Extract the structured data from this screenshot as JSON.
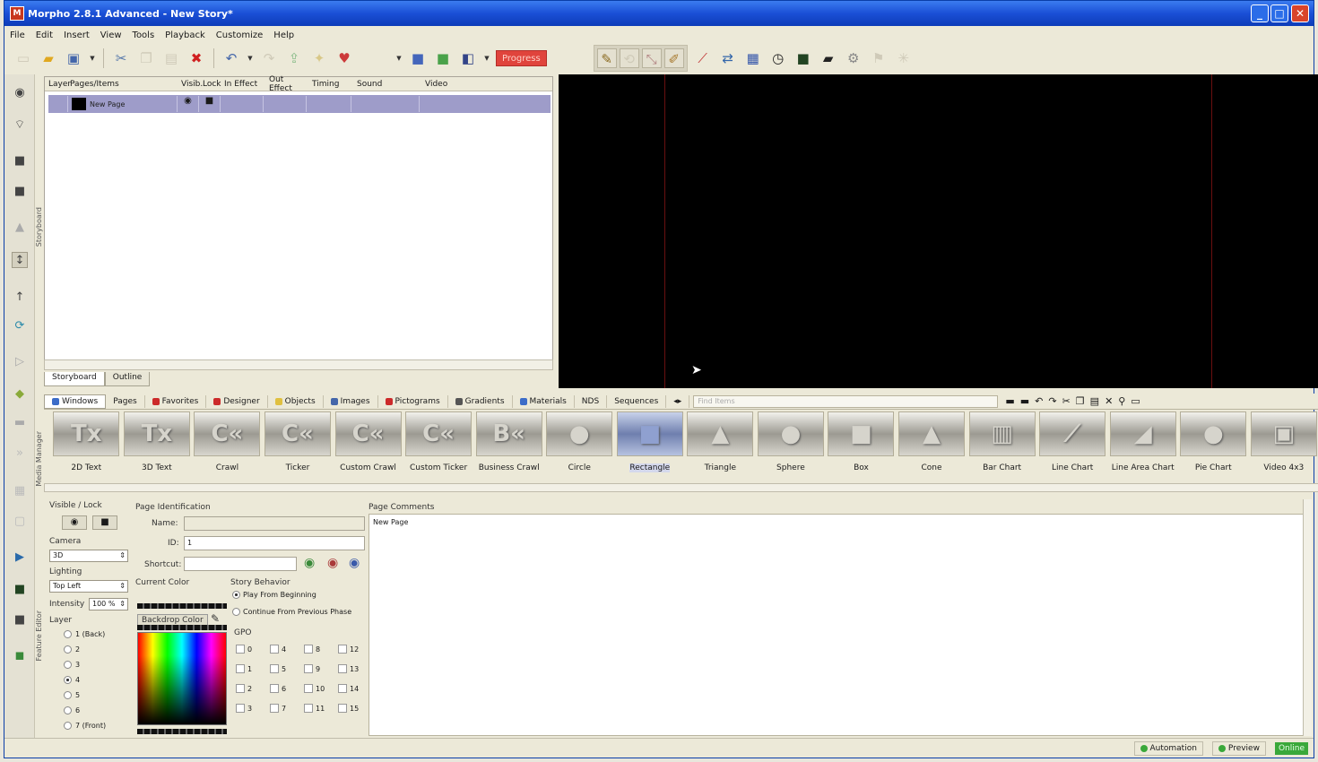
{
  "window": {
    "title": "Morpho 2.8.1 Advanced - New Story*",
    "icon_text": "M"
  },
  "window_controls": {
    "minimize": "_",
    "maximize": "□",
    "close": "✕"
  },
  "menu": [
    "File",
    "Edit",
    "Insert",
    "View",
    "Tools",
    "Playback",
    "Customize",
    "Help"
  ],
  "toolbar": {
    "progress_label": "Progress"
  },
  "storyboard": {
    "columns": [
      "Layer",
      "Pages/Items",
      "Visib.",
      "Lock",
      "In Effect",
      "Out Effect",
      "Timing",
      "Sound",
      "Video"
    ],
    "row": {
      "item_name": "New Page"
    },
    "tabs": [
      "Storyboard",
      "Outline"
    ],
    "side_label": "Storyboard"
  },
  "object_tabs": [
    "Windows",
    "Pages",
    "Favorites",
    "Designer",
    "Objects",
    "Images",
    "Pictograms",
    "Gradients",
    "Materials",
    "NDS",
    "Sequences"
  ],
  "object_tab_colors": [
    "#3c6cc8",
    "#b0a88c",
    "#cc2a2a",
    "#cc2a2a",
    "#e0c040",
    "#4466aa",
    "#cc2a2a",
    "#555555",
    "#3c6cc8",
    "#b0a88c",
    "#b0a88c"
  ],
  "search_placeholder": "Find Items",
  "objects": [
    {
      "label": "2D Text",
      "glyph": "Tx"
    },
    {
      "label": "3D Text",
      "glyph": "Tx"
    },
    {
      "label": "Crawl",
      "glyph": "C«"
    },
    {
      "label": "Ticker",
      "glyph": "C«"
    },
    {
      "label": "Custom Crawl",
      "glyph": "C«"
    },
    {
      "label": "Custom Ticker",
      "glyph": "C«"
    },
    {
      "label": "Business Crawl",
      "glyph": "B«"
    },
    {
      "label": "Circle",
      "glyph": "●"
    },
    {
      "label": "Rectangle",
      "glyph": "■"
    },
    {
      "label": "Triangle",
      "glyph": "▲"
    },
    {
      "label": "Sphere",
      "glyph": "●"
    },
    {
      "label": "Box",
      "glyph": "■"
    },
    {
      "label": "Cone",
      "glyph": "▲"
    },
    {
      "label": "Bar Chart",
      "glyph": "▥"
    },
    {
      "label": "Line Chart",
      "glyph": "⟋"
    },
    {
      "label": "Line Area Chart",
      "glyph": "◢"
    },
    {
      "label": "Pie Chart",
      "glyph": "●"
    },
    {
      "label": "Video 4x3",
      "glyph": "▣"
    }
  ],
  "media_manager_label": "Media Manager",
  "feature_editor_label": "Feature Editor",
  "props": {
    "visible_lock": "Visible / Lock",
    "camera_label": "Camera",
    "camera_value": "3D",
    "lighting_label": "Lighting",
    "lighting_value": "Top Left",
    "intensity_label": "Intensity",
    "intensity_value": "100 %",
    "layer_label": "Layer",
    "layers": [
      "1 (Back)",
      "2",
      "3",
      "4",
      "5",
      "6",
      "7 (Front)"
    ],
    "page_identification": "Page Identification",
    "name_label": "Name:",
    "id_label": "ID:",
    "id_value": "1",
    "shortcut_label": "Shortcut:",
    "current_color": "Current Color",
    "backdrop_color": "Backdrop Color",
    "story_behavior": "Story Behavior",
    "play_from_beginning": "Play From Beginning",
    "continue_from_previous": "Continue From Previous Phase",
    "gpo_label": "GPO",
    "gpo": [
      "0",
      "4",
      "8",
      "12",
      "1",
      "5",
      "9",
      "13",
      "2",
      "6",
      "10",
      "14",
      "3",
      "7",
      "11",
      "15"
    ],
    "page_comments": "Page Comments",
    "comments_text": "New Page"
  },
  "status": {
    "automation": "Automation",
    "preview": "Preview",
    "online": "Online"
  }
}
